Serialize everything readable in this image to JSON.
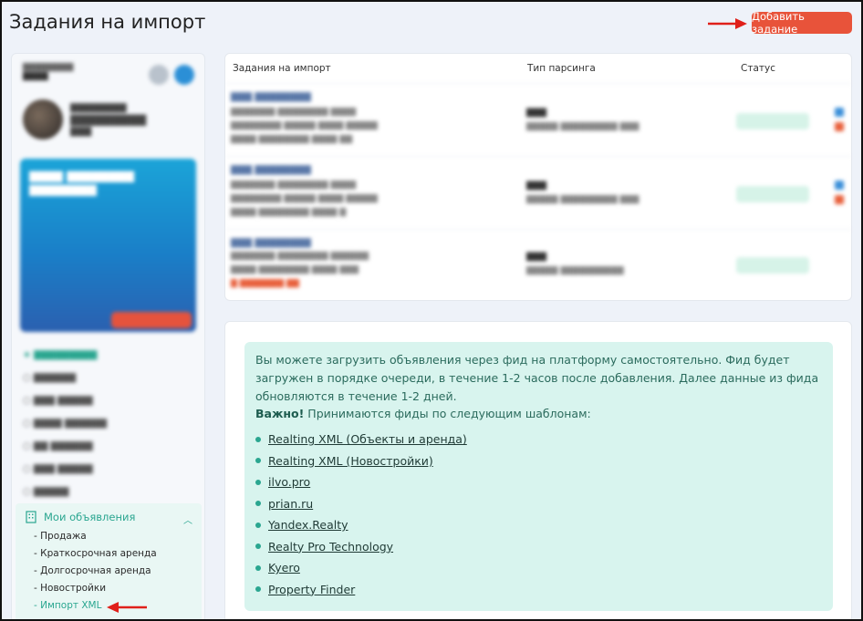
{
  "header": {
    "title": "Задания на импорт",
    "add_button": "Добавить задание"
  },
  "sidebar": {
    "section_label": "Мои объявления",
    "items": [
      {
        "label": "Продажа"
      },
      {
        "label": "Краткосрочная аренда"
      },
      {
        "label": "Долгосрочная аренда"
      },
      {
        "label": "Новостройки"
      },
      {
        "label": "Импорт XML",
        "active": true
      }
    ]
  },
  "table": {
    "columns": [
      "Задания на импорт",
      "Тип парсинга",
      "Статус"
    ]
  },
  "info": {
    "paragraph": "Вы можете загрузить объявления через фид на платформу самостоятельно. Фид будет загружен в порядке очереди, в течение 1-2 часов после добавления. Далее данные из фида обновляются в течение 1-2 дней.",
    "important_label": "Важно!",
    "important_text": " Принимаются фиды по следующим шаблонам:",
    "templates": [
      "Realting XML (Объекты и аренда)",
      "Realting XML (Новостройки)",
      "ilvo.pro",
      "prian.ru",
      "Yandex.Realty",
      "Realty Pro Technology",
      "Kyero",
      "Property Finder"
    ]
  },
  "colors": {
    "accent": "#2aa690",
    "button": "#e8533a",
    "annotation_arrow": "#e0201a",
    "info_bg": "#d8f4ee"
  }
}
